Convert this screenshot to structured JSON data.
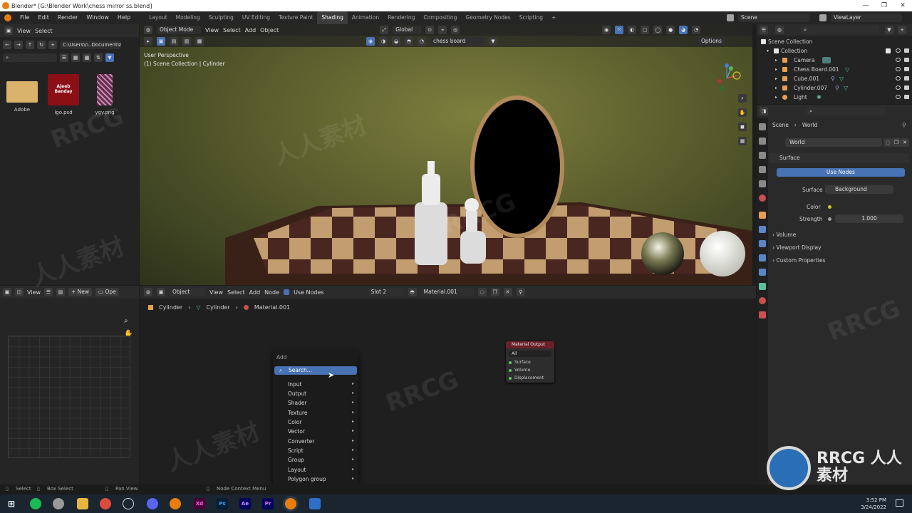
{
  "window": {
    "title": "Blender* [G:\\Blender Work\\chess mirror ss.blend]",
    "controls": [
      "—",
      "❐",
      "✕"
    ]
  },
  "menus": [
    "File",
    "Edit",
    "Render",
    "Window",
    "Help"
  ],
  "workspaces": [
    "Layout",
    "Modeling",
    "Sculpting",
    "UV Editing",
    "Texture Paint",
    "Shading",
    "Animation",
    "Rendering",
    "Compositing",
    "Geometry Nodes",
    "Scripting",
    "+"
  ],
  "scene_field": "Scene",
  "viewlayer_field": "ViewLayer",
  "filebrowser": {
    "menu": [
      "View",
      "Select"
    ],
    "path": "C:\\Users\\n..Documents\\",
    "files": [
      {
        "name": "Adobe",
        "kind": "folder"
      },
      {
        "name": "lgo.psd",
        "kind": "image"
      },
      {
        "name": "ygy.png",
        "kind": "image"
      }
    ],
    "logo_text": "Ajeeb Banday"
  },
  "viewport": {
    "mode": "Object Mode",
    "menu": [
      "View",
      "Select",
      "Add",
      "Object"
    ],
    "orientation": "Global",
    "search_value": "chess board",
    "options_label": "Options",
    "perspective": "User Perspective",
    "collection_info": "(1) Scene Collection | Cylinder"
  },
  "outliner": {
    "root": "Scene Collection",
    "collection": "Collection",
    "items": [
      "Camera",
      "Chess Board.001",
      "Cube.001",
      "Cylinder.007",
      "Light"
    ]
  },
  "properties": {
    "breadcrumb": [
      "Scene",
      "World"
    ],
    "world_name": "World",
    "surface_panel": "Surface",
    "use_nodes_label": "Use Nodes",
    "surface_label": "Surface",
    "surface_value": "Background",
    "color_label": "Color",
    "strength_label": "Strength",
    "strength_value": "1.000",
    "collapsed_panels": [
      "Volume",
      "Viewport Display",
      "Custom Properties"
    ]
  },
  "image_editor": {
    "menu": [
      "View"
    ],
    "new_label": "New",
    "open_label": "Ope"
  },
  "node_editor": {
    "object_label": "Object",
    "menu": [
      "View",
      "Select",
      "Add",
      "Node"
    ],
    "use_nodes_label": "Use Nodes",
    "slot": "Slot 2",
    "material": "Material.001",
    "breadcrumb": [
      "Cylinder",
      "Cylinder",
      "Material.001"
    ],
    "material_output": {
      "title": "Material Output",
      "target": "All",
      "sockets": [
        "Surface",
        "Volume",
        "Displacement"
      ]
    }
  },
  "add_menu": {
    "title": "Add",
    "search": "Search...",
    "items": [
      "Input",
      "Output",
      "Shader",
      "Texture",
      "Color",
      "Vector",
      "Converter",
      "Script",
      "Group",
      "Layout",
      "Polygon group"
    ]
  },
  "statusbar": {
    "select": "Select",
    "box_select": "Box Select",
    "pan_view": "Pan View",
    "context_menu": "Node Context Menu"
  },
  "taskbar": {
    "time": "3:52 PM",
    "date": "3/24/2022",
    "apps": [
      "Xd",
      "Ps",
      "Ae",
      "Pr"
    ]
  },
  "watermarks": [
    "RRCG",
    "人人素材",
    "RRCG 人人素材"
  ],
  "colors": {
    "accent": "#4772b3",
    "node_header": "#6a2027",
    "socket_green": "#63c763",
    "socket_yellow": "#c7c729"
  }
}
